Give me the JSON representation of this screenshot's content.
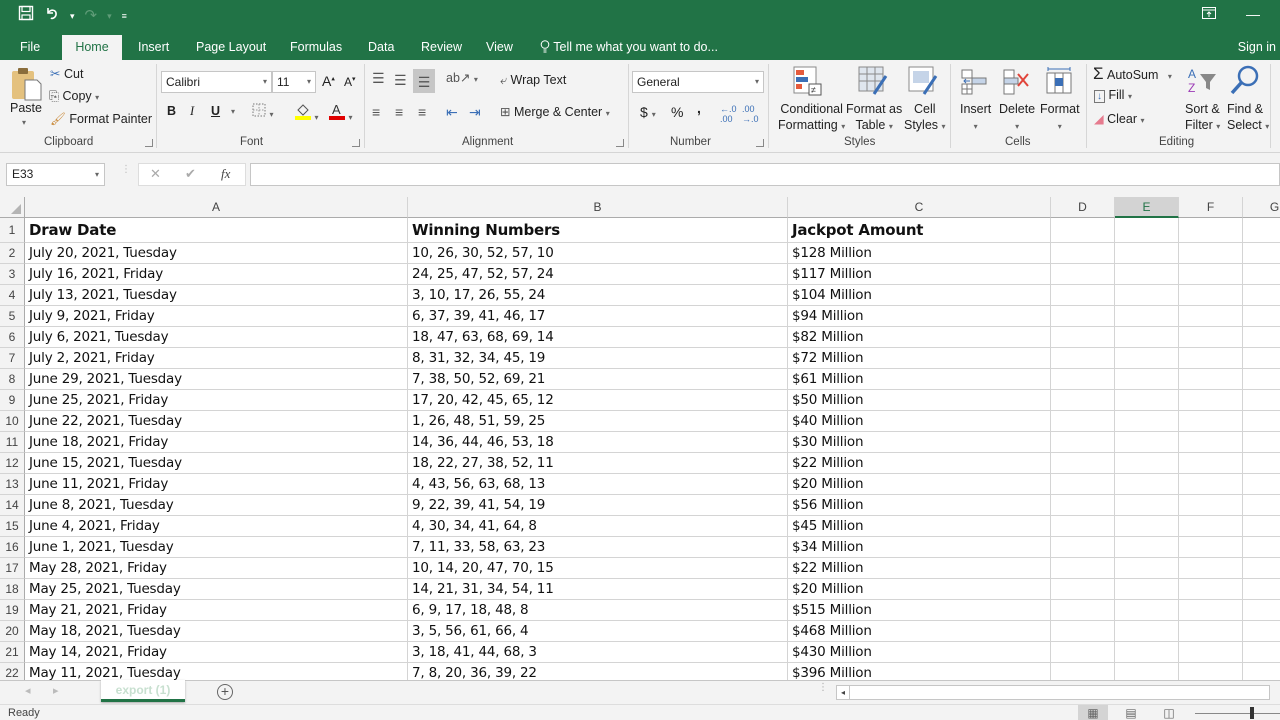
{
  "quick_access": {
    "save_icon": "save-icon",
    "undo_icon": "undo-icon",
    "redo_icon": "redo-icon",
    "customize_icon": "customize-qat-icon"
  },
  "window_controls": {
    "ribbon_display_icon": "ribbon-display-options-icon",
    "minimize_icon": "minimize-icon"
  },
  "tabs": [
    {
      "label": "File"
    },
    {
      "label": "Home",
      "active": true
    },
    {
      "label": "Insert"
    },
    {
      "label": "Page Layout"
    },
    {
      "label": "Formulas"
    },
    {
      "label": "Data"
    },
    {
      "label": "Review"
    },
    {
      "label": "View"
    }
  ],
  "tell_me": "Tell me what you want to do...",
  "sign_in": "Sign in",
  "ribbon": {
    "clipboard": {
      "label": "Clipboard",
      "paste": "Paste",
      "cut": "Cut",
      "copy": "Copy",
      "format_painter": "Format Painter"
    },
    "font": {
      "label": "Font",
      "font_name": "Calibri",
      "font_size": "11",
      "bold": "B",
      "italic": "I",
      "underline": "U",
      "highlight_color": "#ffff00",
      "font_color": "#e00000"
    },
    "alignment": {
      "label": "Alignment",
      "wrap_text": "Wrap Text",
      "merge_center": "Merge & Center"
    },
    "number": {
      "label": "Number",
      "format": "General",
      "currency": "$",
      "percent": "%",
      "comma": ","
    },
    "styles": {
      "label": "Styles",
      "conditional_formatting_1": "Conditional",
      "conditional_formatting_2": "Formatting",
      "format_as_table_1": "Format as",
      "format_as_table_2": "Table",
      "cell_styles_1": "Cell",
      "cell_styles_2": "Styles"
    },
    "cells": {
      "label": "Cells",
      "insert": "Insert",
      "delete": "Delete",
      "format": "Format"
    },
    "editing": {
      "label": "Editing",
      "autosum": "AutoSum",
      "fill": "Fill",
      "clear": "Clear",
      "sort_filter_1": "Sort &",
      "sort_filter_2": "Filter",
      "find_select_1": "Find &",
      "find_select_2": "Select"
    }
  },
  "formula_bar": {
    "name_box": "E33",
    "cancel": "✕",
    "enter": "✔",
    "fx": "fx",
    "value": ""
  },
  "columns": [
    "A",
    "B",
    "C",
    "D",
    "E",
    "F",
    "G"
  ],
  "selected_column": "E",
  "sheet": {
    "header": [
      "Draw Date",
      "Winning Numbers",
      "Jackpot Amount"
    ],
    "rows": [
      [
        "July 20, 2021, Tuesday",
        "10, 26, 30, 52, 57, 10",
        "$128 Million"
      ],
      [
        "July 16, 2021, Friday",
        "24, 25, 47, 52, 57, 24",
        "$117 Million"
      ],
      [
        "July 13, 2021, Tuesday",
        "3, 10, 17, 26, 55, 24",
        "$104 Million"
      ],
      [
        "July 9, 2021, Friday",
        "6, 37, 39, 41, 46, 17",
        "$94 Million"
      ],
      [
        "July 6, 2021, Tuesday",
        "18, 47, 63, 68, 69, 14",
        "$82 Million"
      ],
      [
        "July 2, 2021, Friday",
        "8, 31, 32, 34, 45, 19",
        "$72 Million"
      ],
      [
        "June 29, 2021, Tuesday",
        "7, 38, 50, 52, 69, 21",
        "$61 Million"
      ],
      [
        "June 25, 2021, Friday",
        "17, 20, 42, 45, 65, 12",
        "$50 Million"
      ],
      [
        "June 22, 2021, Tuesday",
        "1, 26, 48, 51, 59, 25",
        "$40 Million"
      ],
      [
        "June 18, 2021, Friday",
        "14, 36, 44, 46, 53, 18",
        "$30 Million"
      ],
      [
        "June 15, 2021, Tuesday",
        "18, 22, 27, 38, 52, 11",
        "$22 Million"
      ],
      [
        "June 11, 2021, Friday",
        "4, 43, 56, 63, 68, 13",
        "$20 Million"
      ],
      [
        "June 8, 2021, Tuesday",
        "9, 22, 39, 41, 54, 19",
        "$56 Million"
      ],
      [
        "June 4, 2021, Friday",
        "4, 30, 34, 41, 64, 8",
        "$45 Million"
      ],
      [
        "June 1, 2021, Tuesday",
        "7, 11, 33, 58, 63, 23",
        "$34 Million"
      ],
      [
        "May 28, 2021, Friday",
        "10, 14, 20, 47, 70, 15",
        "$22 Million"
      ],
      [
        "May 25, 2021, Tuesday",
        "14, 21, 31, 34, 54, 11",
        "$20 Million"
      ],
      [
        "May 21, 2021, Friday",
        "6, 9, 17, 18, 48, 8",
        "$515 Million"
      ],
      [
        "May 18, 2021, Tuesday",
        "3, 5, 56, 61, 66, 4",
        "$468 Million"
      ],
      [
        "May 14, 2021, Friday",
        "3, 18, 41, 44, 68, 3",
        "$430 Million"
      ],
      [
        "May 11, 2021, Tuesday",
        "7, 8, 20, 36, 39, 22",
        "$396 Million"
      ]
    ]
  },
  "sheet_tabs": [
    {
      "label": "export (1)",
      "active": true
    }
  ],
  "status": {
    "text": "Ready",
    "views": [
      "normal-view-icon",
      "page-layout-view-icon",
      "page-break-preview-icon"
    ]
  },
  "colors": {
    "brand": "#217346",
    "ribbon_bg": "#f3f3f3"
  }
}
